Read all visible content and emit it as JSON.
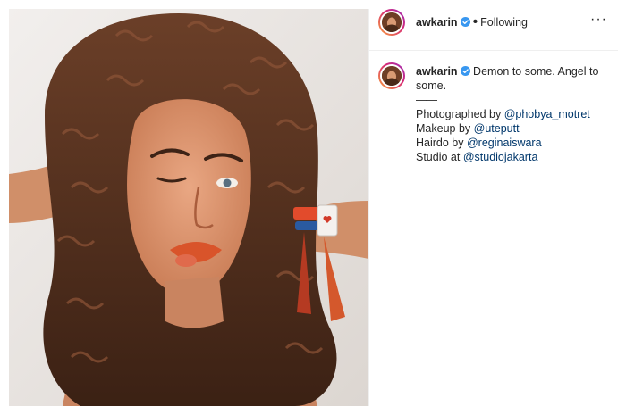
{
  "post": {
    "username": "awkarin",
    "follow_status": "Following",
    "dot": "•",
    "more_label": "···"
  },
  "caption": {
    "username": "awkarin",
    "text": "Demon to some. Angel to some.",
    "divider": "——",
    "credits": [
      {
        "prefix": "Photographed by ",
        "mention": "@phobya_motret"
      },
      {
        "prefix": "Makeup by ",
        "mention": "@uteputt"
      },
      {
        "prefix": "Hairdo by ",
        "mention": "@reginaiswara"
      },
      {
        "prefix": "Studio at ",
        "mention": "@studiojakarta"
      }
    ]
  },
  "colors": {
    "verified_badge": "#3897f0",
    "mention_link": "#00376b",
    "text": "#262626",
    "divider_line": "#efefef"
  },
  "icons": {
    "verified": "verified-badge-icon",
    "more": "more-options-icon"
  }
}
